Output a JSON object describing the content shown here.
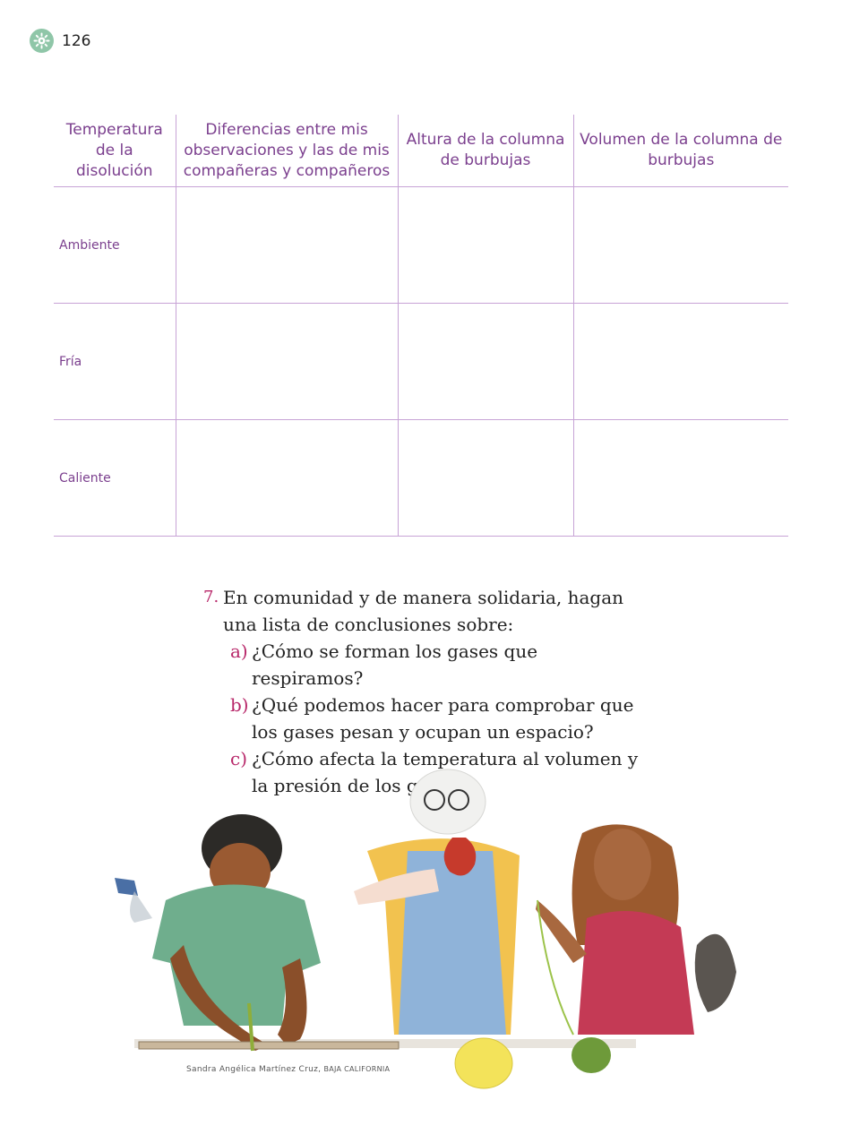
{
  "page": {
    "number": "126",
    "badge_icon": "gear-sun-icon",
    "badge_color": "#8fc6a8"
  },
  "table": {
    "headers": [
      "Temperatura de la disolución",
      "Diferencias entre mis observaciones y las de mis compañeras y compañeros",
      "Altura de la columna de burbujas",
      "Volumen de la columna de burbujas"
    ],
    "rows": [
      "Ambiente",
      "Fría",
      "Caliente"
    ],
    "accent_color": "#7b3f8e",
    "line_color": "#c7a3d6"
  },
  "question": {
    "number": "7.",
    "text": "En comunidad y de manera solidaria, hagan una lista de conclusiones sobre:",
    "items": [
      {
        "letter": "a)",
        "text": "¿Cómo se forman los gases que respiramos?"
      },
      {
        "letter": "b)",
        "text": "¿Qué podemos hacer para comprobar que los gases pesan y ocupan un espacio?"
      },
      {
        "letter": "c)",
        "text": "¿Cómo afecta la temperatura al volumen y la presión de los gases?"
      }
    ],
    "marker_color": "#b8286a"
  },
  "illustration": {
    "credit_name": "Sandra Angélica Martínez Cruz,",
    "credit_place": "BAJA CALIFORNIA"
  }
}
